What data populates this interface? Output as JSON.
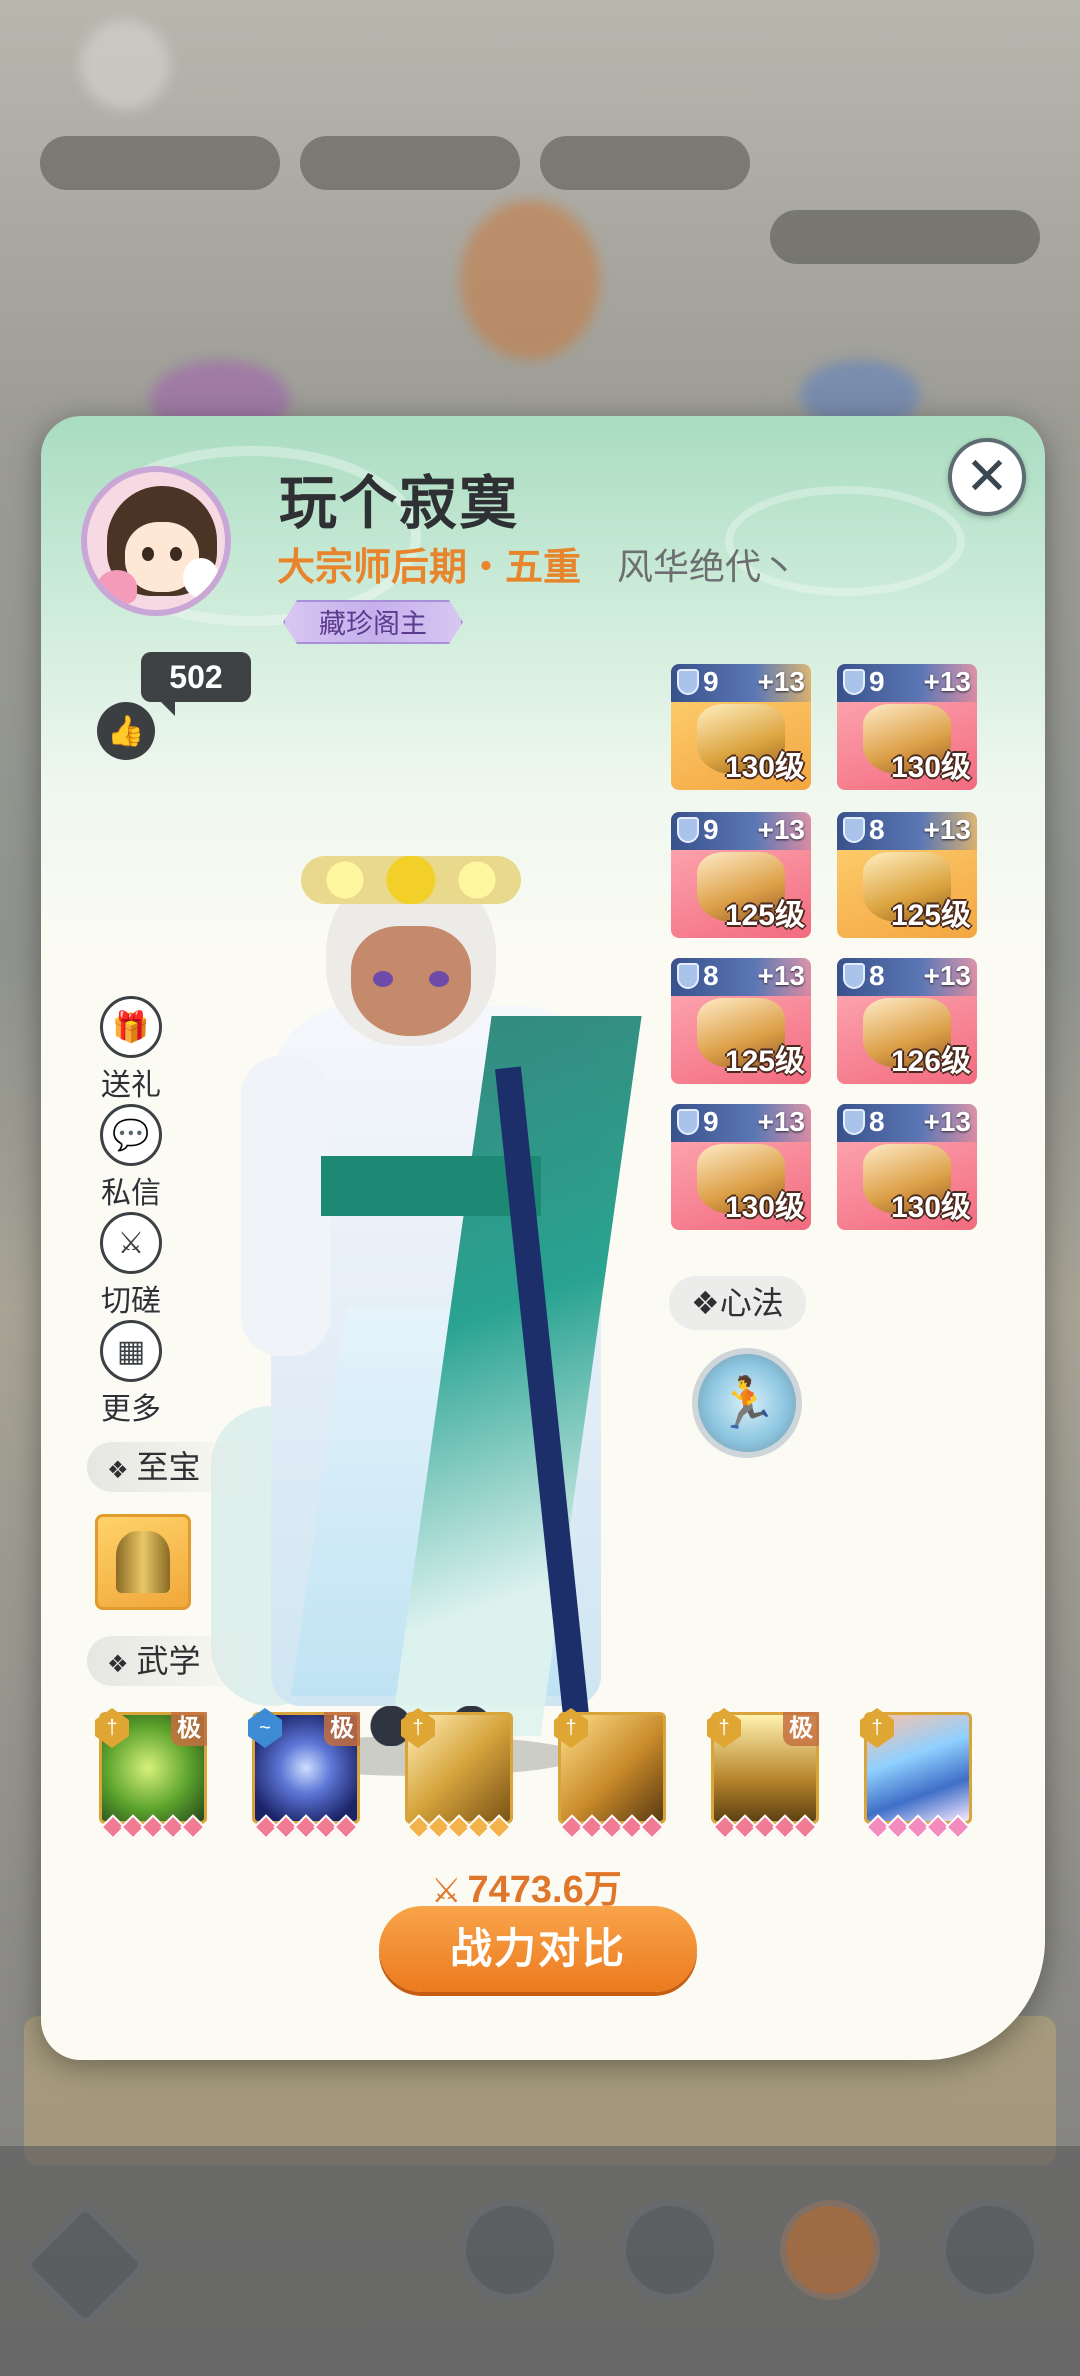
{
  "player": {
    "name": "玩个寂寞",
    "realm": "大宗师后期・五重",
    "guild": "风华绝代丶",
    "title_badge": "藏珍阁主",
    "likes": "502"
  },
  "side_actions": [
    {
      "label": "送礼",
      "icon": "gift-icon"
    },
    {
      "label": "私信",
      "icon": "message-icon"
    },
    {
      "label": "切磋",
      "icon": "crossed-swords-icon"
    },
    {
      "label": "更多",
      "icon": "more-grid-icon"
    }
  ],
  "equipment": [
    {
      "gem": "9",
      "enhance": "+13",
      "level": "130级",
      "rarity": "gold"
    },
    {
      "gem": "9",
      "enhance": "+13",
      "level": "130级",
      "rarity": "red"
    },
    {
      "gem": "9",
      "enhance": "+13",
      "level": "125级",
      "rarity": "red"
    },
    {
      "gem": "8",
      "enhance": "+13",
      "level": "125级",
      "rarity": "gold"
    },
    {
      "gem": "8",
      "enhance": "+13",
      "level": "125级",
      "rarity": "red"
    },
    {
      "gem": "8",
      "enhance": "+13",
      "level": "126级",
      "rarity": "red"
    },
    {
      "gem": "9",
      "enhance": "+13",
      "level": "130级",
      "rarity": "red"
    },
    {
      "gem": "8",
      "enhance": "+13",
      "level": "130级",
      "rarity": "red"
    }
  ],
  "sections": {
    "xinfa": "心法",
    "zhibao": "至宝",
    "wuxue": "武学"
  },
  "skills": [
    {
      "ji": "极",
      "art": "green-vortex",
      "color": "#5aa22c"
    },
    {
      "ji": "极",
      "art": "blue-orb",
      "color": "#2d3f9e"
    },
    {
      "ji": "",
      "art": "gold-blades",
      "color": "#d6a43c"
    },
    {
      "ji": "",
      "art": "gold-arrows",
      "color": "#c88a2a"
    },
    {
      "ji": "极",
      "art": "gold-swords",
      "color": "#b8862c"
    },
    {
      "ji": "",
      "art": "comet",
      "color": "#3f6fc8"
    }
  ],
  "power": {
    "value": "7473.6万"
  },
  "compare_button": "战力对比",
  "colors": {
    "accent_orange": "#ec7a1f",
    "realm_orange": "#e8842b",
    "title_purple": "#5c3a8f"
  }
}
